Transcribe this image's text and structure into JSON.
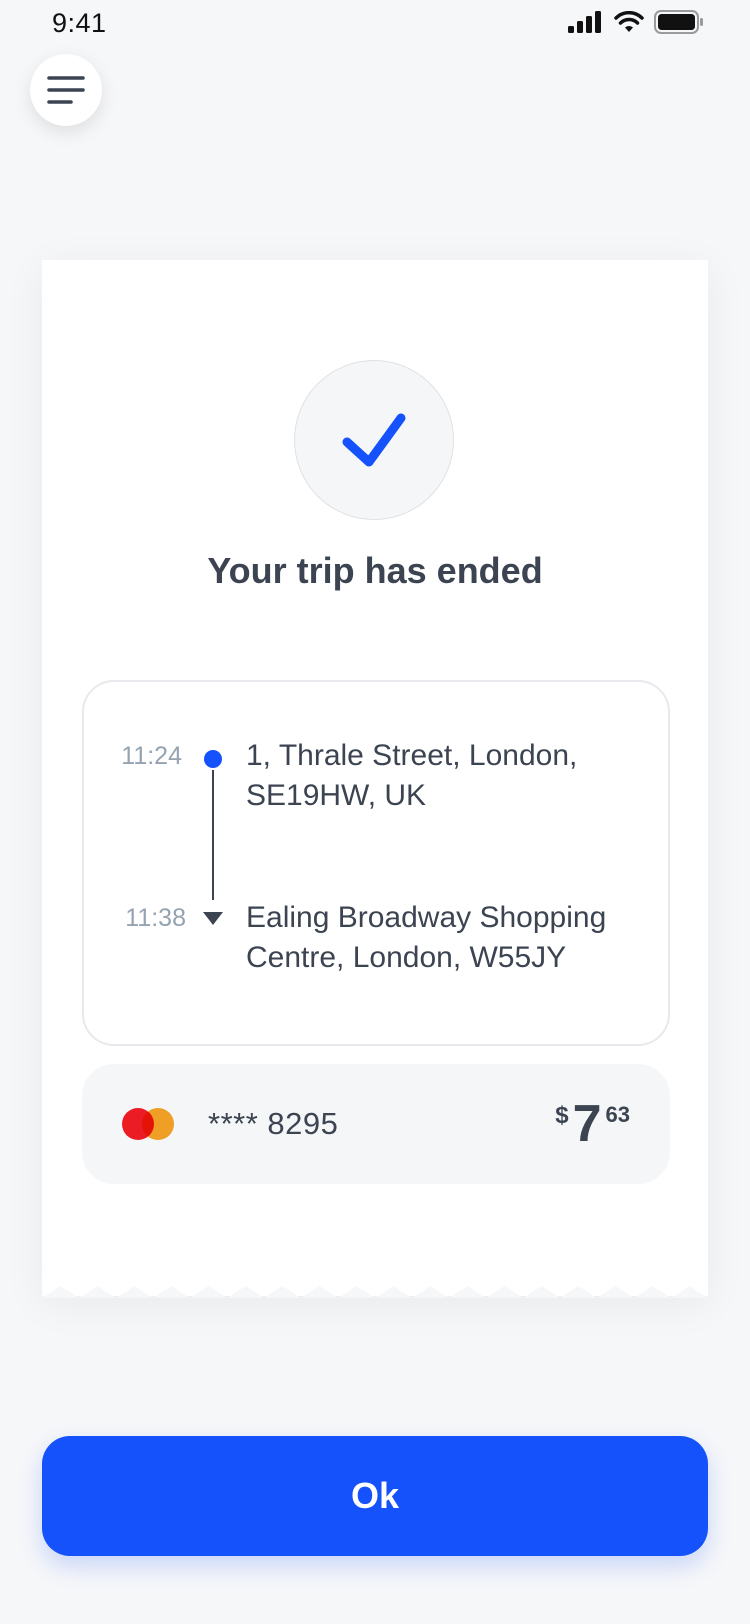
{
  "status_bar": {
    "time": "9:41",
    "icons": [
      "signal-icon",
      "wifi-icon",
      "battery-icon"
    ]
  },
  "menu": {
    "icon": "hamburger-menu-icon"
  },
  "receipt": {
    "status_icon": "checkmark-icon",
    "title": "Your trip has ended",
    "route": {
      "start": {
        "time": "11:24",
        "address_line1": "1, Thrale Street, London,",
        "address_line2": "SE19HW, UK"
      },
      "end": {
        "time": "11:38",
        "address_line1": "Ealing Broadway Shopping",
        "address_line2": "Centre, London, W55JY"
      }
    },
    "payment": {
      "card_brand_icon": "mastercard-icon",
      "card_number": "**** 8295",
      "currency": "$",
      "amount_whole": "7",
      "amount_cents": "63"
    }
  },
  "actions": {
    "ok_label": "Ok"
  },
  "colors": {
    "accent": "#1552fb",
    "text": "#3c4452",
    "muted": "#95a3b1",
    "background": "#f6f7f9"
  }
}
